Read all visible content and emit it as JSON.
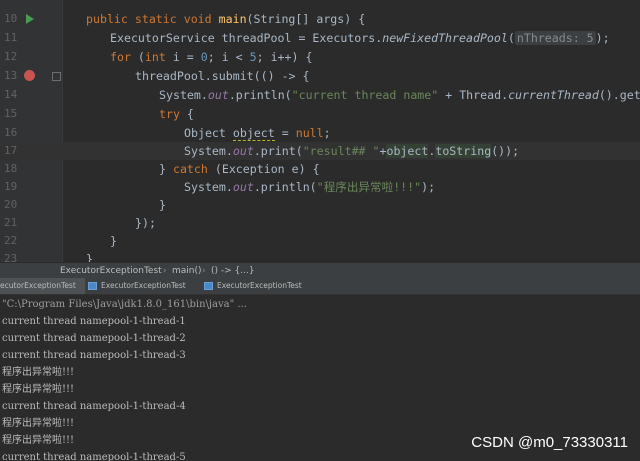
{
  "editor": {
    "lines": [
      {
        "num": "10"
      },
      {
        "num": "11"
      },
      {
        "num": "12"
      },
      {
        "num": "13"
      },
      {
        "num": "14"
      },
      {
        "num": "15"
      },
      {
        "num": "16"
      },
      {
        "num": "17"
      },
      {
        "num": "18"
      },
      {
        "num": "19"
      },
      {
        "num": "20"
      },
      {
        "num": "21"
      },
      {
        "num": "22"
      },
      {
        "num": "23"
      }
    ],
    "code": {
      "l10_kw": "public static void ",
      "l10_fn": "main",
      "l10_rest": "(String[] args) {",
      "l11_a": "ExecutorService threadPool = Executors.",
      "l11_st": "newFixedThreadPool",
      "l11_b": "(",
      "l11_hint": "nThreads: 5",
      "l11_c": ");",
      "l12_for": "for ",
      "l12_a": "(",
      "l12_int": "int ",
      "l12_b": "i = ",
      "l12_zero": "0",
      "l12_c": "; i < ",
      "l12_five": "5",
      "l12_d": "; i++) {",
      "l13": "threadPool.submit(() -> {",
      "l14_a": "System.",
      "l14_out": "out",
      "l14_b": ".println(",
      "l14_str": "\"current thread name\"",
      "l14_c": " + Thread.",
      "l14_st": "currentThread",
      "l14_d": "().getName());",
      "l15_try": "try ",
      "l15_brace": "{",
      "l16_a": "Object ",
      "l16_obj": "object",
      "l16_b": " = ",
      "l16_null": "null",
      "l16_c": ";",
      "l17_a": "System.",
      "l17_out": "out",
      "l17_b": ".print(",
      "l17_str": "\"result## \"",
      "l17_c": "+",
      "l17_obj": "object",
      "l17_d": ".",
      "l17_ts": "toString",
      "l17_e": "());",
      "l18_a": "} ",
      "l18_catch": "catch ",
      "l18_b": "(Exception e) {",
      "l19_a": "System.",
      "l19_out": "out",
      "l19_b": ".println(",
      "l19_str": "\"程序出异常啦!!!\"",
      "l19_c": ");",
      "l20": "}",
      "l21": "});",
      "l22": "}",
      "l23": "}"
    }
  },
  "breadcrumb": {
    "items": [
      "ExecutorExceptionTest",
      "main()",
      "() -> {...}"
    ],
    "separator": "›"
  },
  "run_tabs": [
    {
      "label": "ecutorExceptionTest"
    },
    {
      "label": "ExecutorExceptionTest"
    },
    {
      "label": "ExecutorExceptionTest"
    }
  ],
  "console": {
    "lines": [
      "\"C:\\Program Files\\Java\\jdk1.8.0_161\\bin\\java\" ...",
      "current thread namepool-1-thread-1",
      "current thread namepool-1-thread-2",
      "current thread namepool-1-thread-3",
      "程序出异常啦!!!",
      "程序出异常啦!!!",
      "current thread namepool-1-thread-4",
      "程序出异常啦!!!",
      "程序出异常啦!!!",
      "current thread namepool-1-thread-5"
    ]
  },
  "watermark": "CSDN @m0_73330311",
  "colors": {
    "editor_bg": "#2b2b2b",
    "keyword": "#cc7832",
    "string": "#6a8759",
    "number": "#6897bb",
    "field": "#9876aa",
    "method_decl": "#ffc66d"
  }
}
